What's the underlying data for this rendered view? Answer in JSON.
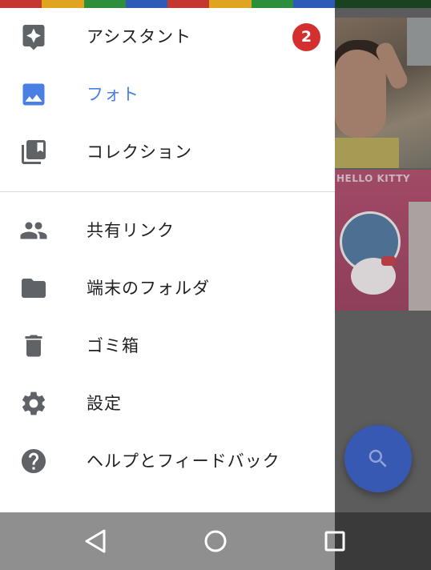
{
  "drawer": {
    "items": [
      {
        "id": "assistant",
        "label": "アシスタント",
        "icon": "assistant-icon",
        "badge": "2"
      },
      {
        "id": "photos",
        "label": "フォト",
        "icon": "photo-icon",
        "active": true
      },
      {
        "id": "collections",
        "label": "コレクション",
        "icon": "collections-icon"
      },
      {
        "id": "shared-links",
        "label": "共有リンク",
        "icon": "people-icon"
      },
      {
        "id": "device-folders",
        "label": "端末のフォルダ",
        "icon": "folder-icon"
      },
      {
        "id": "trash",
        "label": "ゴミ箱",
        "icon": "trash-icon"
      },
      {
        "id": "settings",
        "label": "設定",
        "icon": "gear-icon"
      },
      {
        "id": "help",
        "label": "ヘルプとフィードバック",
        "icon": "help-icon"
      }
    ]
  },
  "background": {
    "photo_caption_text": "HELLO KITTY"
  },
  "fab": {
    "icon": "search-icon"
  },
  "navbar": {
    "buttons": [
      "back-icon",
      "home-icon",
      "recents-icon"
    ]
  },
  "colors": {
    "accent": "#4a7fe4",
    "icon_gray": "#5f6368",
    "badge_red": "#d32f2f",
    "fab_blue": "#3758b3"
  }
}
